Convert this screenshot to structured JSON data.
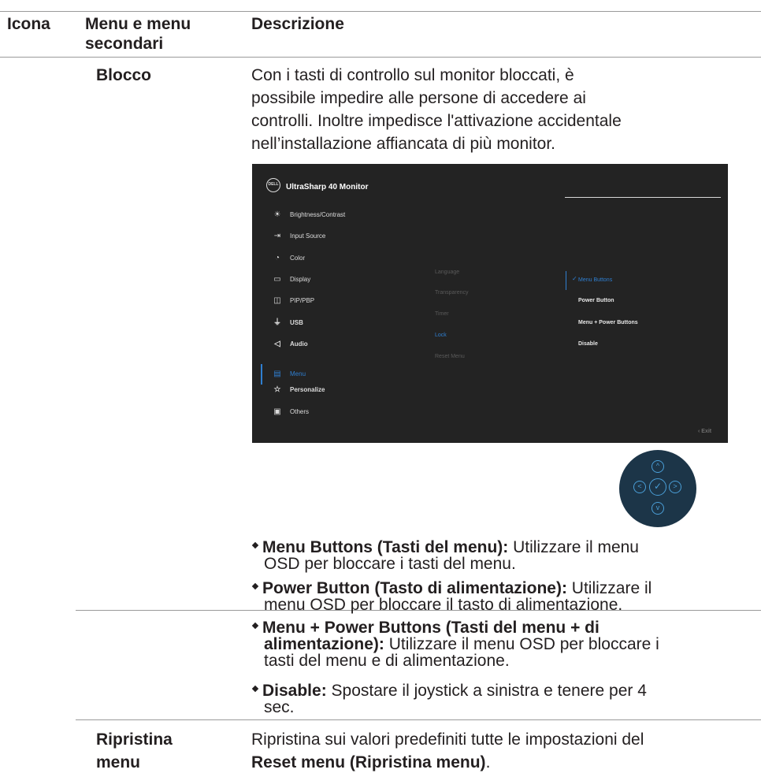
{
  "header": {
    "col1": "Icona",
    "col2_line1": "Menu e menu",
    "col2_line2": "secondari",
    "col3": "Descrizione"
  },
  "row_lock": {
    "label": "Blocco",
    "desc_lines": [
      "Con i tasti di controllo sul monitor bloccati, è",
      "possibile impedire alle persone di accedere ai",
      "controlli. Inoltre impedisce l'attivazione accidentale",
      "nell’installazione affiancata di più monitor."
    ]
  },
  "osd": {
    "logo": "DELL",
    "title": "UltraSharp 40 Monitor",
    "menu": [
      {
        "icon": "brightness-icon",
        "glyph": "☀",
        "label": "Brightness/Contrast"
      },
      {
        "icon": "input-source-icon",
        "glyph": "⇥",
        "label": "Input Source"
      },
      {
        "icon": "color-icon",
        "glyph": "◔",
        "label": "Color"
      },
      {
        "icon": "display-icon",
        "glyph": "▭",
        "label": "Display"
      },
      {
        "icon": "pip-pbp-icon",
        "glyph": "◫",
        "label": "PIP/PBP"
      },
      {
        "icon": "usb-icon",
        "glyph": "⏚",
        "label": "USB"
      },
      {
        "icon": "audio-icon",
        "glyph": "◁",
        "label": "Audio"
      },
      {
        "icon": "menu-icon",
        "glyph": "▤",
        "label": "Menu"
      },
      {
        "icon": "star-icon",
        "glyph": "☆",
        "label": "Personalize"
      },
      {
        "icon": "others-icon",
        "glyph": "▣",
        "label": "Others"
      }
    ],
    "submenu": [
      "Language",
      "Transparency",
      "Timer",
      "Lock",
      "Reset Menu"
    ],
    "options": [
      "Menu Buttons",
      "Power Button",
      "Menu + Power Buttons",
      "Disable"
    ],
    "exit": "Exit",
    "accent": "#2f7fd1"
  },
  "joystick": {
    "up": "^",
    "left": "<",
    "center": "✓",
    "right": ">",
    "down": "v"
  },
  "bullets": [
    {
      "bold": "Menu Buttons (Tasti del menu):",
      "text": " Utilizzare il menu",
      "line2": "OSD per bloccare i tasti del menu."
    },
    {
      "bold": "Power Button (Tasto di alimentazione):",
      "text": " Utilizzare il",
      "line2": "menu OSD per bloccare il tasto di alimentazione."
    },
    {
      "bold": "Menu + Power Buttons (Tasti del menu + di",
      "bold2": "alimentazione):",
      "text": " Utilizzare il menu OSD per bloccare i",
      "line3": "tasti del menu e di alimentazione."
    },
    {
      "bold": "Disable:",
      "text": " Spostare il joystick a sinistra e tenere per 4",
      "line2": "sec."
    }
  ],
  "row_reset": {
    "label_line1": "Ripristina",
    "label_line2": "menu",
    "desc_line1": "Ripristina sui valori predefiniti tutte le impostazioni del",
    "desc_bold": "Reset menu (Ripristina menu)",
    "desc_end": "."
  }
}
